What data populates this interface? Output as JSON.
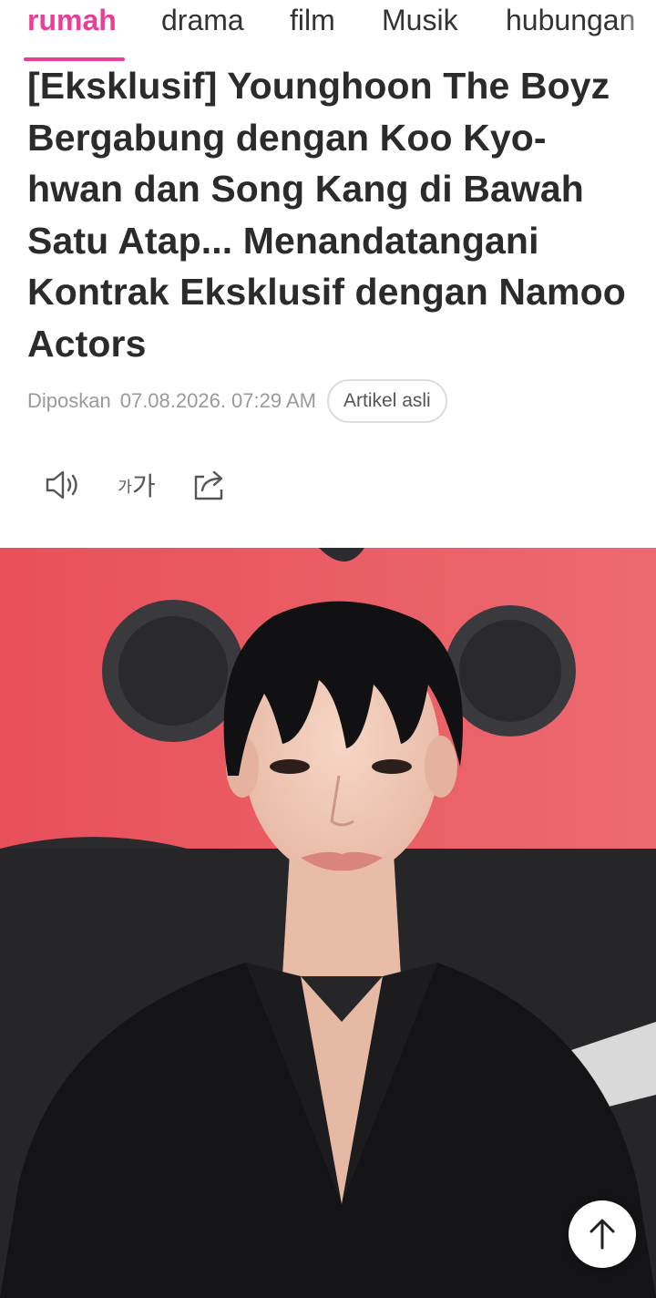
{
  "nav": {
    "tabs": [
      {
        "label": "rumah",
        "active": true
      },
      {
        "label": "drama",
        "active": false
      },
      {
        "label": "film",
        "active": false
      },
      {
        "label": "Musik",
        "active": false
      },
      {
        "label": "hubungan",
        "active": false
      }
    ]
  },
  "article": {
    "title": "[Eksklusif] Younghoon The Boyz Bergabung dengan Koo Kyo-hwan dan Song Kang di Bawah Satu Atap... Menandatangani Kontrak Eksklusif dengan Namoo Actors",
    "posted_label": "Diposkan",
    "posted_datetime": "07.08.2026. 07:29 AM",
    "original_button": "Artikel asli"
  },
  "tools": {
    "listen_icon": "speaker-icon",
    "font_size_small": "가",
    "font_size_big": "가",
    "share_icon": "share-icon"
  },
  "hero": {
    "icon": "photo-portrait",
    "colors": {
      "backdrop_red": "#e84a55",
      "backdrop_dark": "#232326",
      "suit": "#141416"
    }
  },
  "scroll_top": {
    "icon": "arrow-up-icon"
  },
  "colors": {
    "accent": "#e83e98",
    "text": "#2b2b2b",
    "muted": "#9a9a9a"
  }
}
